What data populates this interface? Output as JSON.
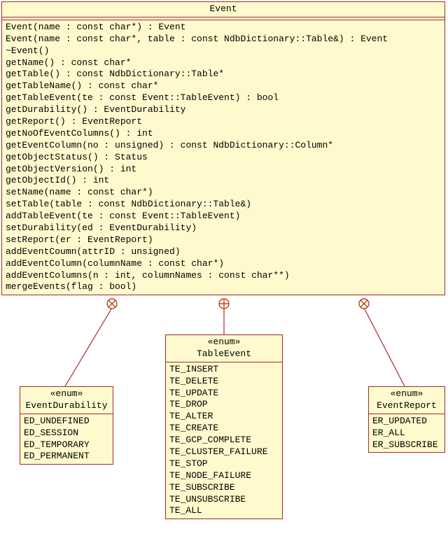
{
  "classes": {
    "event": {
      "title": "Event",
      "members": [
        "Event(name : const char*) : Event",
        "Event(name : const char*, table : const NdbDictionary::Table&) : Event",
        "~Event()",
        "getName() : const char*",
        "getTable() : const NdbDictionary::Table*",
        "getTableName() : const char*",
        "getTableEvent(te : const Event::TableEvent) : bool",
        "getDurability() : EventDurability",
        "getReport() : EventReport",
        "getNoOfEventColumns() : int",
        "getEventColumn(no : unsigned) : const NdbDictionary::Column*",
        "getObjectStatus() : Status",
        "getObjectVersion() : int",
        "getObjectId() : int",
        "setName(name : const char*)",
        "setTable(table : const NdbDictionary::Table&)",
        "addTableEvent(te : const Event::TableEvent)",
        "setDurability(ed : EventDurability)",
        "setReport(er : EventReport)",
        "addEventCoumn(attrID : unsigned)",
        "addEventColumn(columnName : const char*)",
        "addEventColumns(n : int, columnNames : const char**)",
        "mergeEvents(flag : bool)"
      ]
    },
    "eventDurability": {
      "stereotype": "«enum»",
      "title": "EventDurability",
      "members": [
        "ED_UNDEFINED",
        "ED_SESSION",
        "ED_TEMPORARY",
        "ED_PERMANENT"
      ]
    },
    "tableEvent": {
      "stereotype": "«enum»",
      "title": "TableEvent",
      "members": [
        "TE_INSERT",
        "TE_DELETE",
        "TE_UPDATE",
        "TE_DROP",
        "TE_ALTER",
        "TE_CREATE",
        "TE_GCP_COMPLETE",
        "TE_CLUSTER_FAILURE",
        "TE_STOP",
        "TE_NODE_FAILURE",
        "TE_SUBSCRIBE",
        "TE_UNSUBSCRIBE",
        "TE_ALL"
      ]
    },
    "eventReport": {
      "stereotype": "«enum»",
      "title": "EventReport",
      "members": [
        "ER_UPDATED",
        "ER_ALL",
        "ER_SUBSCRIBE"
      ]
    }
  }
}
